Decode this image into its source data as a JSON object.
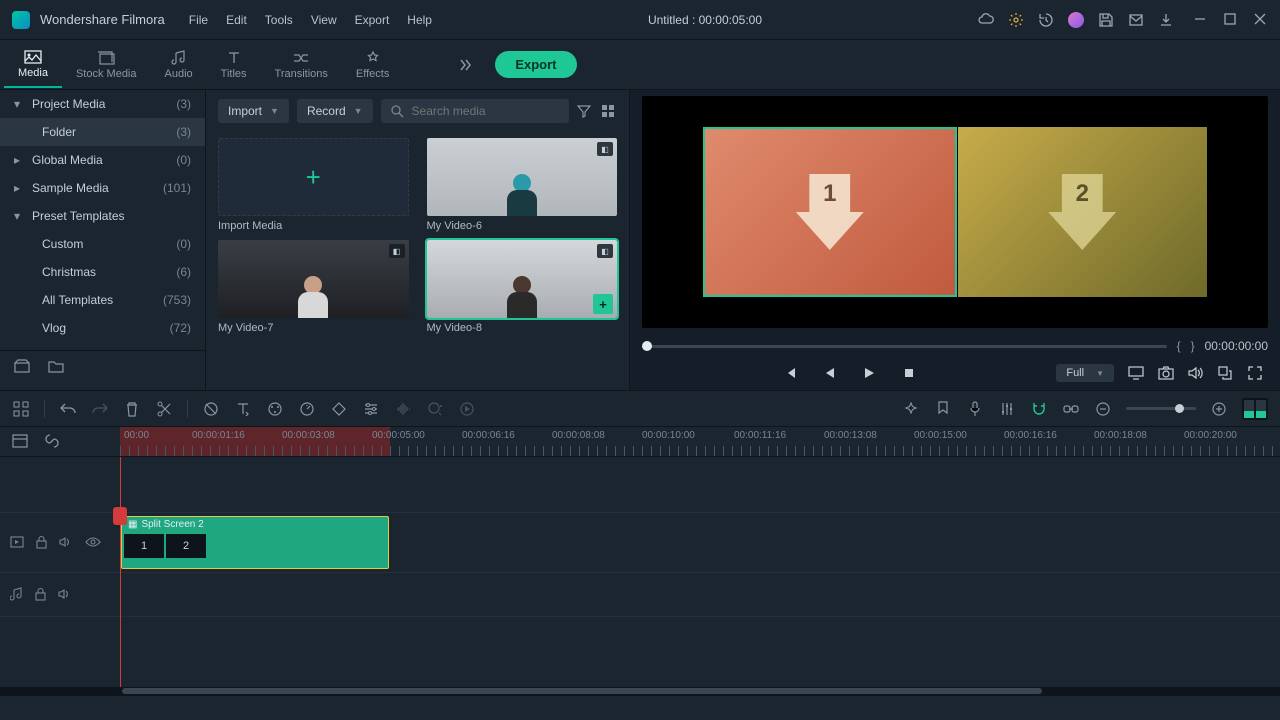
{
  "app_name": "Wondershare Filmora",
  "menu": [
    "File",
    "Edit",
    "Tools",
    "View",
    "Export",
    "Help"
  ],
  "title_center": "Untitled : 00:00:05:00",
  "export_label": "Export",
  "tabs": [
    {
      "label": "Media"
    },
    {
      "label": "Stock Media"
    },
    {
      "label": "Audio"
    },
    {
      "label": "Titles"
    },
    {
      "label": "Transitions"
    },
    {
      "label": "Effects"
    }
  ],
  "sidebar": [
    {
      "label": "Project Media",
      "count": "(3)",
      "expandable": true,
      "open": true
    },
    {
      "label": "Folder",
      "count": "(3)",
      "child": true,
      "selected": true
    },
    {
      "label": "Global Media",
      "count": "(0)",
      "expandable": true
    },
    {
      "label": "Sample Media",
      "count": "(101)",
      "expandable": true
    },
    {
      "label": "Preset Templates",
      "count": "",
      "expandable": true,
      "open": true
    },
    {
      "label": "Custom",
      "count": "(0)",
      "child": true
    },
    {
      "label": "Christmas",
      "count": "(6)",
      "child": true
    },
    {
      "label": "All Templates",
      "count": "(753)",
      "child": true
    },
    {
      "label": "Vlog",
      "count": "(72)",
      "child": true
    }
  ],
  "media_toolbar": {
    "import": "Import",
    "record": "Record",
    "search_placeholder": "Search media"
  },
  "media_items": [
    {
      "label": "Import Media",
      "import": true
    },
    {
      "label": "My Video-6"
    },
    {
      "label": "My Video-7"
    },
    {
      "label": "My Video-8",
      "selected": true,
      "add": true
    }
  ],
  "preview": {
    "left_num": "1",
    "right_num": "2",
    "timecode": "00:00:00:00",
    "full": "Full"
  },
  "ruler_ticks": [
    "00:00",
    "00:00:01:16",
    "00:00:03:08",
    "00:00:05:00",
    "00:00:06:16",
    "00:00:08:08",
    "00:00:10:00",
    "00:00:11:16",
    "00:00:13:08",
    "00:00:15:00",
    "00:00:16:16",
    "00:00:18:08",
    "00:00:20:00"
  ],
  "clip": {
    "title": "Split Screen 2",
    "slots": [
      "1",
      "2"
    ]
  }
}
